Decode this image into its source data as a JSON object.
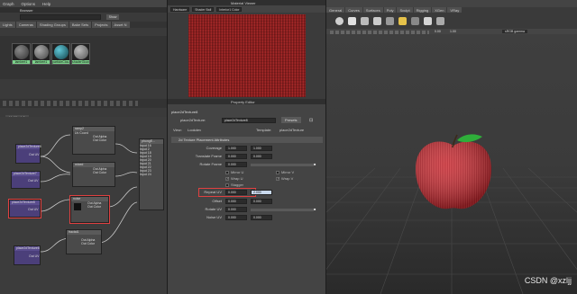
{
  "hypershade": {
    "menu": [
      "Graph",
      "Options",
      "Help"
    ],
    "browser_title": "Browser",
    "tabs": [
      "Lights",
      "Cameras",
      "Shading Groups",
      "Bake Sets",
      "Projects",
      "Asset N"
    ],
    "search_button": "Show",
    "swatches": [
      {
        "label": "lambert1",
        "color": "#5a5a5a"
      },
      {
        "label": "lambert1",
        "color": "#777"
      },
      {
        "label": "particleClou...",
        "color": "#2a6f7a"
      },
      {
        "label": "shaderGlow1",
        "color": "#777"
      }
    ],
    "graph_tab": "Untitled_1",
    "nodes": {
      "p2d_1": "place2dTexture8",
      "ramp": "ramp2",
      "p2d_2": "place2dTexture7",
      "mixed1": "mixed",
      "p2d_3": "place2dTexture8",
      "noise": "noise",
      "fractal": "fractal1",
      "p2d_4": "place2dTexture6",
      "phong": "phongE...",
      "out_uv": "Out UV",
      "uv_coord": "Uv Coord",
      "out_alpha": "Out Alpha",
      "out_color": "Out Color"
    },
    "phong_inputs": [
      "Input 16",
      "Input 2",
      "Input 18",
      "Input 19",
      "Input 20",
      "Input 21",
      "Input 22",
      "Input 23",
      "Input 24"
    ]
  },
  "material_viewer": {
    "title": "Material Viewer",
    "renderer": "Hardware",
    "shape": "Shader Ball",
    "env": "Interior1 Color"
  },
  "property_editor": {
    "title": "Property Editor",
    "node_tab": "place2dTexture8",
    "node_label": "place2dTexture:",
    "node_value": "place2dTexture8",
    "presets_button": "Presets",
    "view_label": "View:",
    "view_value": "Lookdev",
    "template_label": "Template:",
    "template_value": "place2dTexture",
    "section": "2d Texture Placement Attributes",
    "coverage_label": "Coverage",
    "coverage": [
      "1.000",
      "1.000"
    ],
    "translate_label": "Translate Frame",
    "translate": [
      "0.000",
      "0.000"
    ],
    "rotate_frame_label": "Rotate Frame",
    "rotate_frame": "0.000",
    "mirror_u": "Mirror U",
    "mirror_v": "Mirror V",
    "wrap_u": "Wrap U",
    "wrap_v": "Wrap V",
    "stagger": "Stagger",
    "repeat_label": "Repeat UV",
    "repeat": [
      "0.000",
      "2.000"
    ],
    "offset_label": "Offset",
    "offset": [
      "0.000",
      "0.000"
    ],
    "rotate_uv_label": "Rotate UV",
    "rotate_uv": "0.000",
    "noise_label": "Noise UV",
    "noise": [
      "0.000",
      "0.000"
    ]
  },
  "viewport": {
    "menu": [
      "View",
      "Shading",
      "Lighting",
      "Show",
      "Renderer",
      "Panels"
    ],
    "tabs": [
      "General",
      "Curves",
      "Surfaces",
      "Poly",
      "Sculpt",
      "Rigging",
      "XGen",
      "VRay"
    ],
    "field_a": "0.00",
    "field_b": "1.00",
    "color_space": "sRGB gamma"
  },
  "watermark": "CSDN @xzljj",
  "colors": {
    "apple_red": "#c0262c",
    "leaf_green": "#2fae3a",
    "selection_red": "#e04040"
  }
}
